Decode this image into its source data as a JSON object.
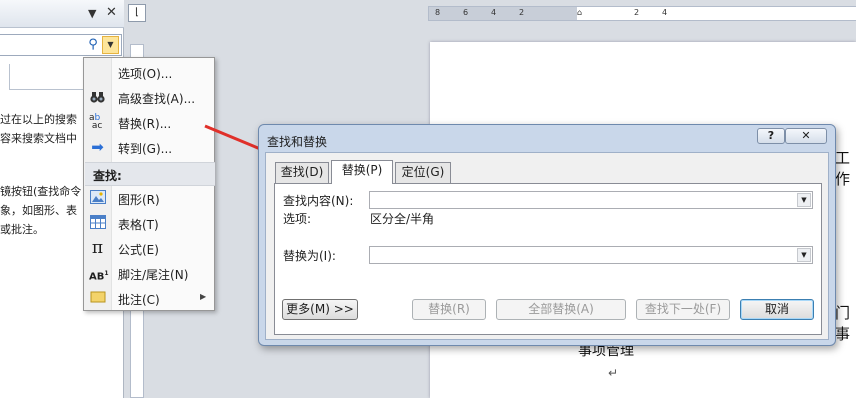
{
  "nav_pane": {
    "help_lines": [
      "过在以上的搜索",
      "容来搜索文档中",
      "",
      "镜按钮(查找命令",
      "象，如图形、表",
      "或批注。"
    ]
  },
  "ruler": {
    "ticks": [
      "8",
      "6",
      "4",
      "2",
      "",
      "2",
      "4"
    ]
  },
  "document": {
    "text_right_1": "工作",
    "text_right_2": "门事",
    "text_bottom": "事项管理",
    "paragraph_mark": "↵"
  },
  "menu": {
    "items": [
      {
        "label": "选项(O)...",
        "icon": "blank"
      },
      {
        "label": "高级查找(A)...",
        "icon": "binoculars-icon"
      },
      {
        "label": "替换(R)...",
        "icon": "replace-icon"
      },
      {
        "label": "转到(G)...",
        "icon": "arrow-right-icon"
      }
    ],
    "section_header": "查找:",
    "find_items": [
      {
        "label": "图形(R)",
        "icon": "picture-icon"
      },
      {
        "label": "表格(T)",
        "icon": "table-icon"
      },
      {
        "label": "公式(E)",
        "icon": "pi-icon"
      },
      {
        "label": "脚注/尾注(N)",
        "icon": "footnote-icon"
      },
      {
        "label": "批注(C)",
        "icon": "comment-icon"
      }
    ],
    "icon_colors": {
      "arrow": "#2b6fd6",
      "picture": "#4a7fc7",
      "comment": "#e6c24a"
    }
  },
  "dialog": {
    "title": "查找和替换",
    "help_button": "?",
    "close_button": "✕",
    "tabs": [
      "查找(D)",
      "替换(P)",
      "定位(G)"
    ],
    "active_tab": "替换(P)",
    "find_label": "查找内容(N):",
    "find_value": "",
    "options_label": "选项:",
    "options_value": "区分全/半角",
    "replace_label": "替换为(I):",
    "replace_value": "",
    "buttons": {
      "more": "更多(M) >>",
      "replace": "替换(R)",
      "replace_all": "全部替换(A)",
      "find_next": "查找下一处(F)",
      "cancel": "取消"
    }
  },
  "annotation": {
    "arrow_color": "#e0302a"
  }
}
